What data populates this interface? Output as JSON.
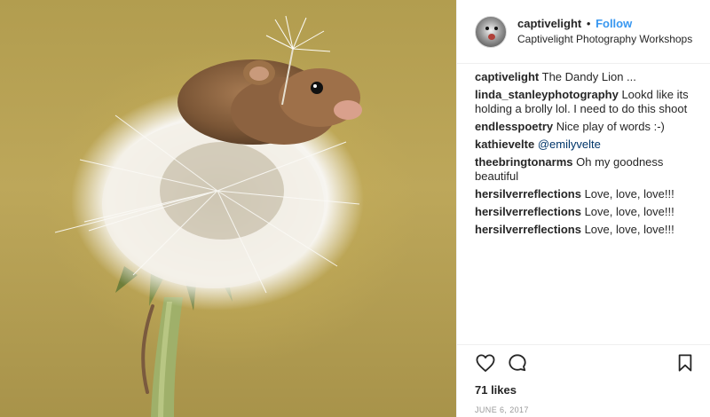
{
  "header": {
    "username": "captivelight",
    "separator": "•",
    "follow_label": "Follow",
    "location": "Captivelight Photography Workshops"
  },
  "media": {
    "icon": "photo-harvest-mouse-on-dandelion"
  },
  "comments": [
    {
      "user": "captivelight",
      "text": "The Dandy Lion ..."
    },
    {
      "user": "linda_stanleyphotography",
      "text": "Lookd like its holding a brolly lol. I need to do this shoot"
    },
    {
      "user": "endlesspoetry",
      "text": "Nice play of words :-)"
    },
    {
      "user": "kathievelte",
      "mention": "@emilyvelte",
      "text": ""
    },
    {
      "user": "theebringtonarms",
      "text": "Oh my goodness beautiful"
    },
    {
      "user": "hersilverreflections",
      "text": "Love, love, love!!!"
    },
    {
      "user": "hersilverreflections",
      "text": "Love, love, love!!!"
    },
    {
      "user": "hersilverreflections",
      "text": "Love, love, love!!!"
    }
  ],
  "footer": {
    "likes": "71 likes",
    "date": "JUNE 6, 2017",
    "icons": [
      "heart-icon",
      "comment-icon",
      "bookmark-icon"
    ]
  },
  "colors": {
    "link": "#3897f0",
    "mention": "#003569",
    "text": "#262626",
    "muted": "#999999"
  }
}
